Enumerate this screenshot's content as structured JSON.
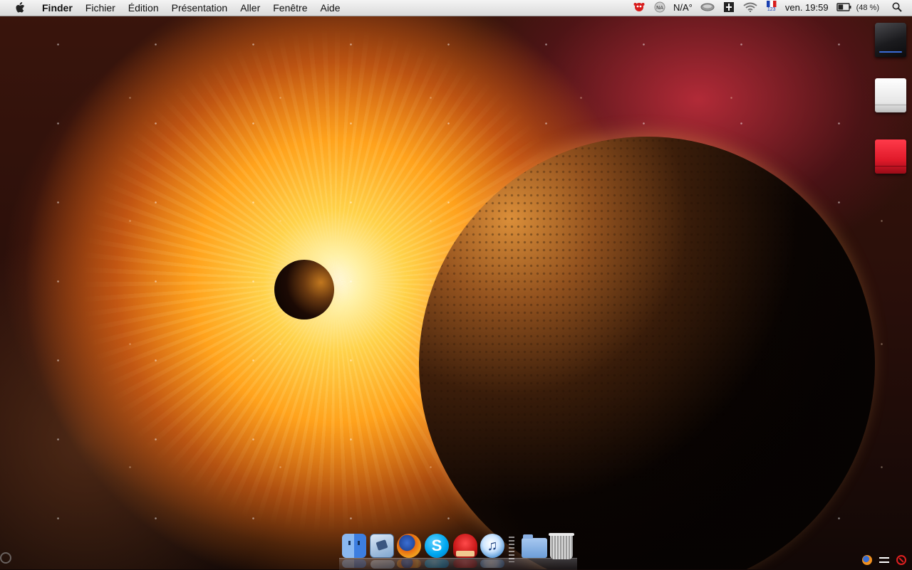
{
  "menubar": {
    "app_name": "Finder",
    "menus": [
      "Fichier",
      "Édition",
      "Présentation",
      "Aller",
      "Fenêtre",
      "Aide"
    ],
    "status": {
      "weather_text": "N/A°",
      "flag_sub": "123",
      "clock": "ven. 19:59",
      "battery": "(48 %)",
      "battery_level": 0.48
    }
  },
  "desktop": {
    "icons": [
      "dark-hard-drive-icon",
      "white-drive-icon",
      "red-drive-icon"
    ]
  },
  "dock": {
    "apps": [
      "finder-icon",
      "mail-icon",
      "firefox-icon",
      "skype-icon",
      "adium-icon",
      "itunes-icon",
      "documents-folder-icon",
      "trash-icon"
    ]
  },
  "colors": {
    "menubar": "#e8e8e8",
    "wallpaper_glow": "#ffd24a",
    "nebula_red": "#dc3246"
  }
}
